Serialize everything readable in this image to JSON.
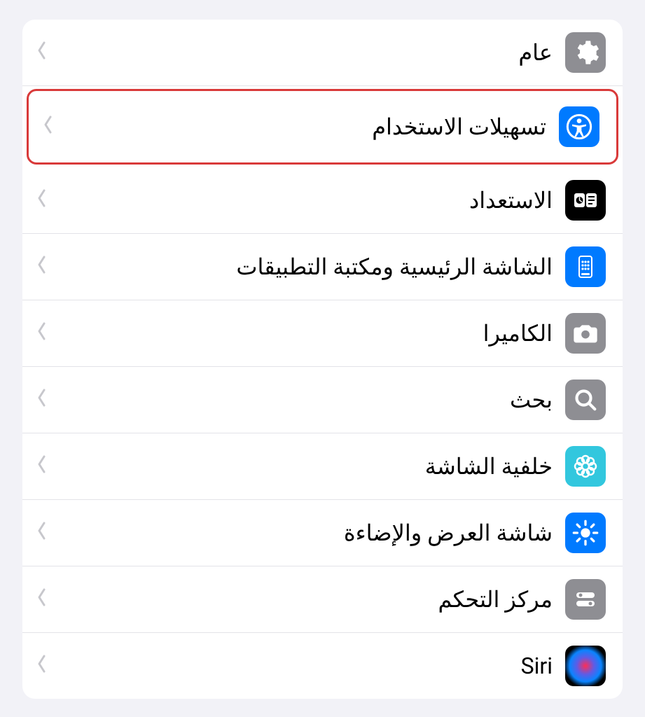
{
  "settings": {
    "items": [
      {
        "label": "عام"
      },
      {
        "label": "تسهيلات الاستخدام"
      },
      {
        "label": "الاستعداد"
      },
      {
        "label": "الشاشة الرئيسية ومكتبة التطبيقات"
      },
      {
        "label": "الكاميرا"
      },
      {
        "label": "بحث"
      },
      {
        "label": "خلفية الشاشة"
      },
      {
        "label": "شاشة العرض والإضاءة"
      },
      {
        "label": "مركز التحكم"
      },
      {
        "label": "Siri"
      }
    ]
  }
}
